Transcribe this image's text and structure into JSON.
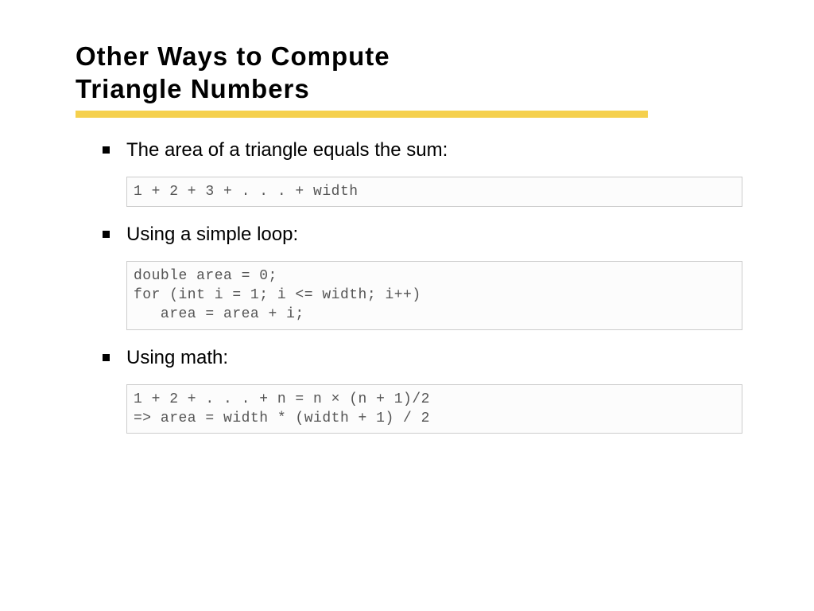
{
  "title_line1": "Other Ways to Compute",
  "title_line2": "Triangle Numbers",
  "bullets": [
    {
      "text": "The area of a triangle equals the sum:",
      "code": "1 + 2 + 3 + . . . + width"
    },
    {
      "text": "Using a simple loop:",
      "code": "double area = 0;\nfor (int i = 1; i <= width; i++)\n   area = area + i;"
    },
    {
      "text": "Using math:",
      "code": "1 + 2 + . . . + n = n × (n + 1)/2\n=> area = width * (width + 1) / 2"
    }
  ]
}
